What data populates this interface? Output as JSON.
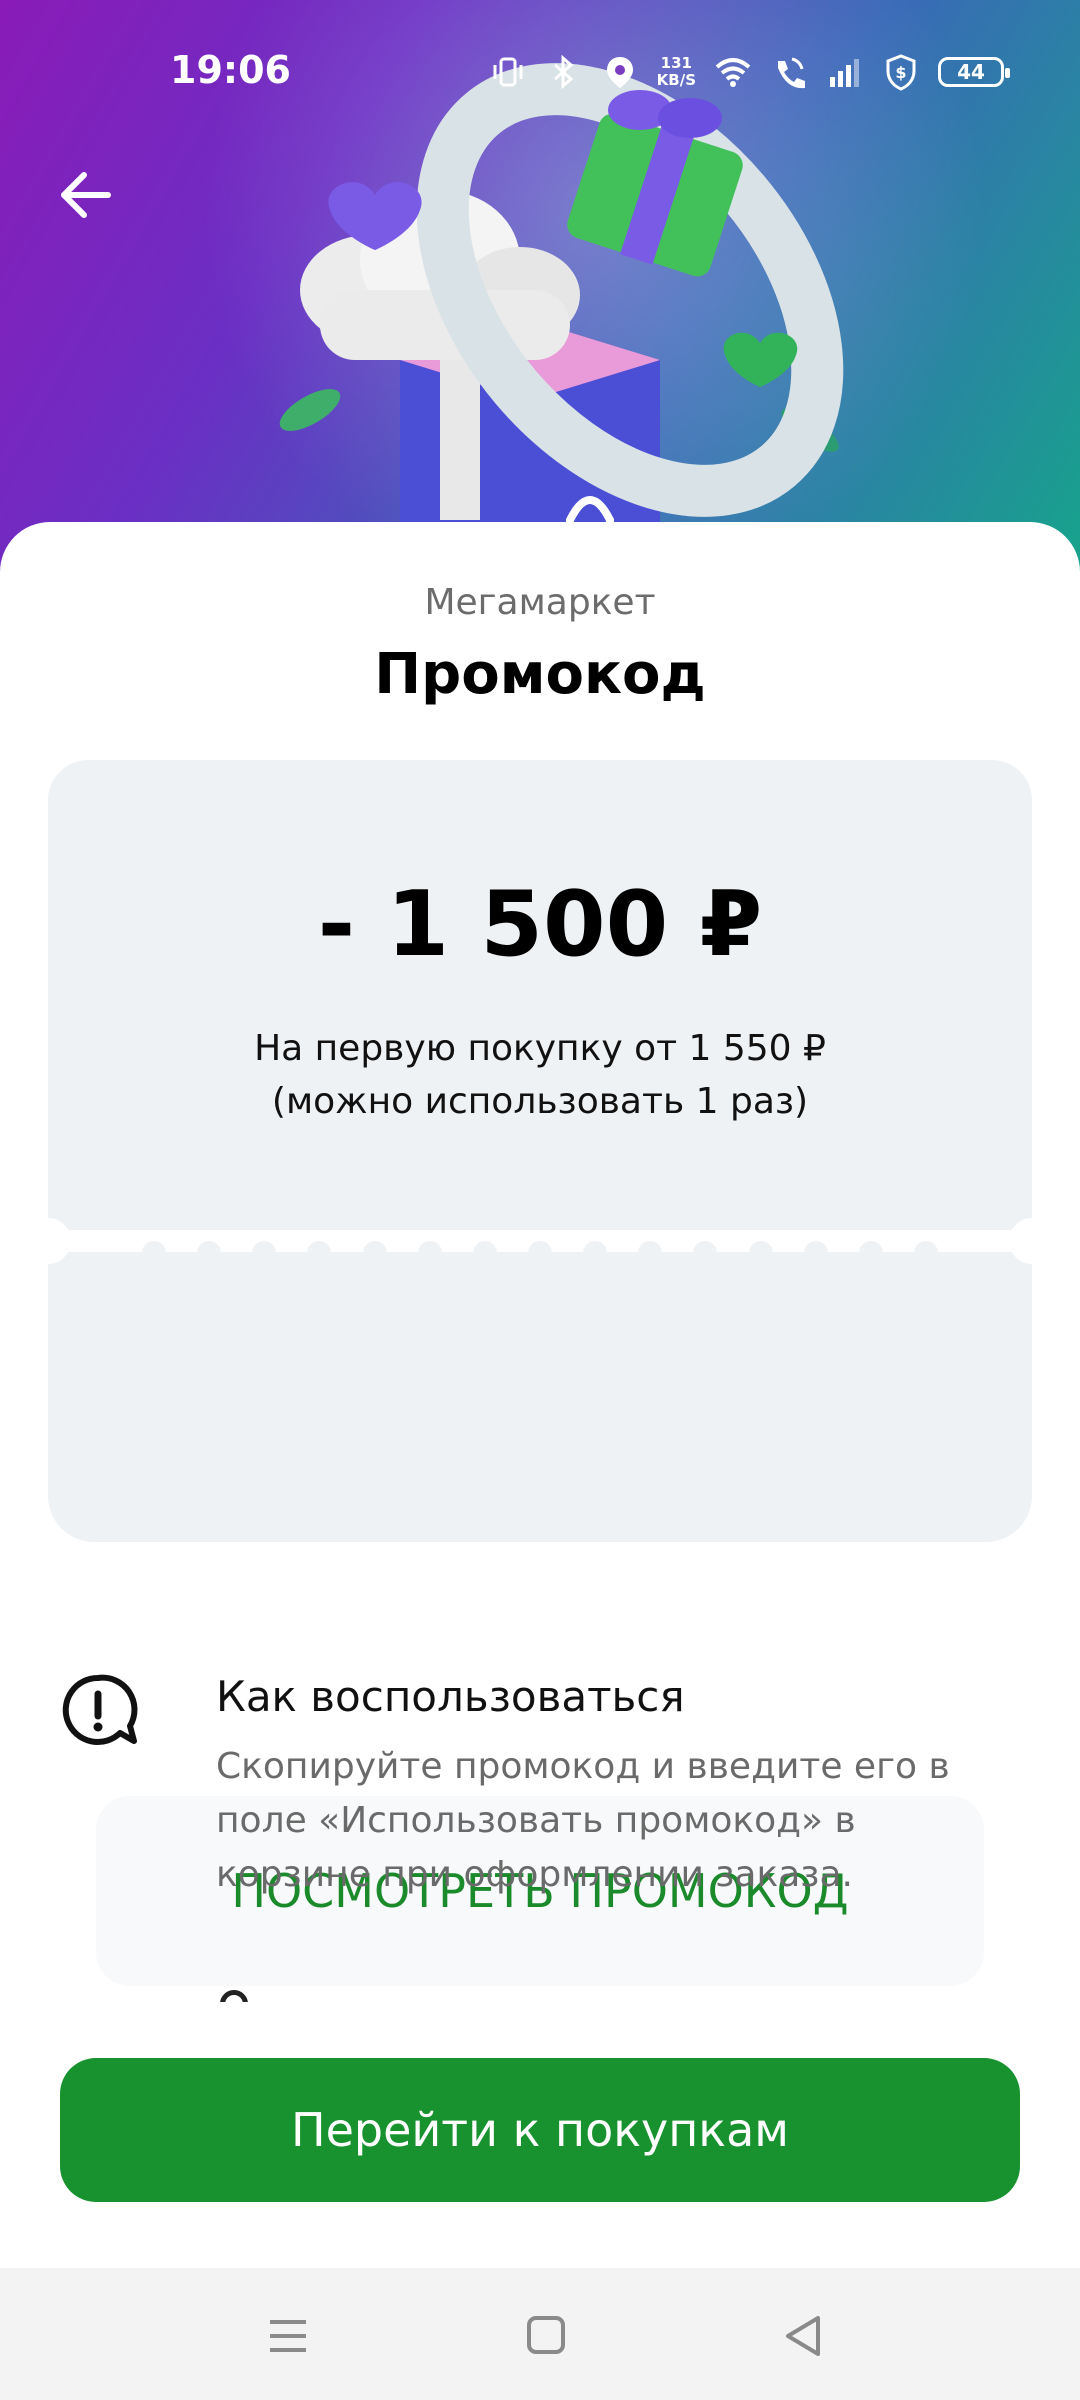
{
  "status_bar": {
    "time": "19:06",
    "net_speed_value": "131",
    "net_speed_unit": "KB/S",
    "battery": "44",
    "icons": [
      "vibrate-icon",
      "bluetooth-icon",
      "location-icon",
      "wifi-icon",
      "wifi-call-icon",
      "signal-icon",
      "shield-dollar-icon",
      "battery-icon"
    ]
  },
  "header": {
    "back_icon": "arrow-left-icon"
  },
  "promo": {
    "brand": "Мегамаркет",
    "title": "Промокод",
    "amount": "- 1 500 ₽",
    "condition_line1": "На первую покупку от 1 550 ₽",
    "condition_line2": "(можно использовать 1 раз)",
    "view_button_label": "ПОСМОТРЕТЬ ПРОМОКОД"
  },
  "how_to": {
    "icon": "speech-bubble-exclamation-icon",
    "title": "Как воспользоваться",
    "text": "Скопируйте промокод и введите его в поле «Использовать промокод» в корзине при оформлении заказа."
  },
  "footer": {
    "shop_button_label": "Перейти к покупкам"
  },
  "navbar": {
    "icons": [
      "menu-icon",
      "home-square-icon",
      "back-triangle-icon"
    ]
  },
  "colors": {
    "accent_green": "#18922f",
    "link_green": "#1a8a2b",
    "card_bg": "#eff2f5"
  }
}
